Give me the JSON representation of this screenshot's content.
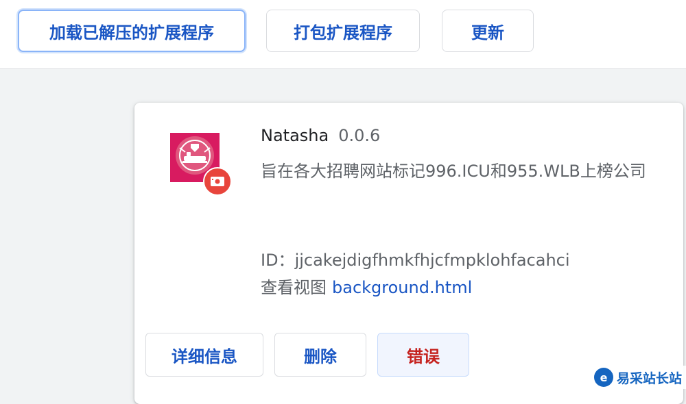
{
  "toolbar": {
    "load_unpacked_label": "加载已解压的扩展程序",
    "pack_label": "打包扩展程序",
    "update_label": "更新"
  },
  "extension": {
    "name": "Natasha",
    "version": "0.0.6",
    "description": "旨在各大招聘网站标记996.ICU和955.WLB上榜公司",
    "id_label": "ID：",
    "id": "jjcakejdigfhmkfhjcfmpklohfacahci",
    "views_label": "查看视图",
    "views_link": "background.html",
    "icon_color": "#d81b60",
    "badge_color": "#e8453c"
  },
  "card_actions": {
    "details_label": "详细信息",
    "remove_label": "删除",
    "errors_label": "错误"
  },
  "watermark": {
    "text": "易采站长站",
    "logo": "e"
  },
  "colors": {
    "accent": "#1a56c4",
    "error": "#c5221f",
    "page_bg": "#f1f3f4"
  }
}
